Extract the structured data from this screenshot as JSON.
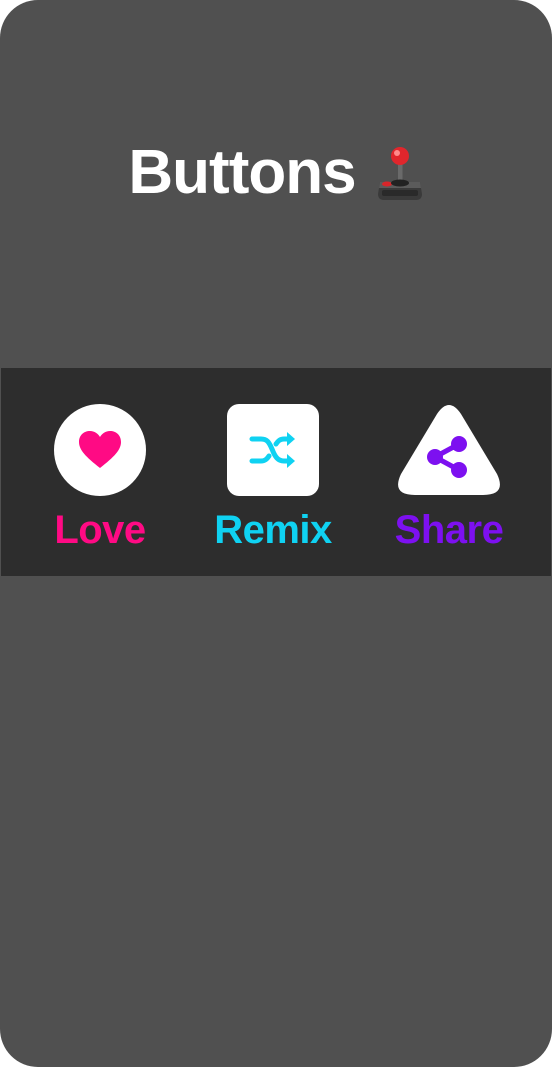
{
  "header": {
    "title": "Buttons",
    "emoji_icon": "joystick-icon"
  },
  "buttons": [
    {
      "label": "Love",
      "icon": "heart-icon",
      "shape": "circle",
      "color": "#ff0a84"
    },
    {
      "label": "Remix",
      "icon": "shuffle-icon",
      "shape": "rounded-square",
      "color": "#0fd2f2"
    },
    {
      "label": "Share",
      "icon": "share-icon",
      "shape": "triangle",
      "color": "#7d10f0"
    }
  ],
  "colors": {
    "background": "#505050",
    "toolbar": "#2d2d2d",
    "button_bg": "#ffffff",
    "title": "#ffffff"
  }
}
